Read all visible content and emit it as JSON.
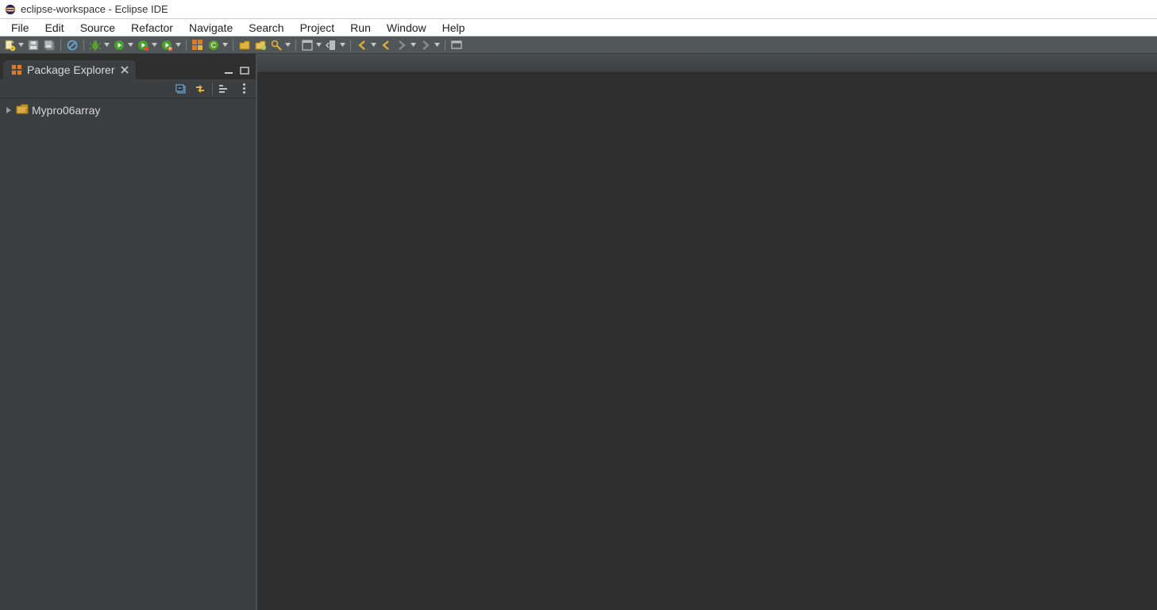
{
  "window": {
    "title": "eclipse-workspace - Eclipse IDE"
  },
  "menubar": {
    "items": [
      "File",
      "Edit",
      "Source",
      "Refactor",
      "Navigate",
      "Search",
      "Project",
      "Run",
      "Window",
      "Help"
    ]
  },
  "toolbar": {
    "groups": [
      {
        "items": [
          {
            "name": "new-button",
            "kind": "new",
            "drop": true
          },
          {
            "name": "save-button",
            "kind": "save",
            "drop": false
          },
          {
            "name": "save-all-button",
            "kind": "saveall",
            "drop": false
          }
        ]
      },
      {
        "items": [
          {
            "name": "skip-breakpoints-button",
            "kind": "skipbp",
            "drop": false
          }
        ]
      },
      {
        "items": [
          {
            "name": "debug-button",
            "kind": "debug",
            "drop": true
          },
          {
            "name": "run-button",
            "kind": "run",
            "drop": true
          },
          {
            "name": "coverage-button",
            "kind": "coverage",
            "drop": true
          },
          {
            "name": "external-tools-button",
            "kind": "ext",
            "drop": true
          }
        ]
      },
      {
        "items": [
          {
            "name": "new-package-button",
            "kind": "newpkg",
            "drop": false
          },
          {
            "name": "new-class-button",
            "kind": "newclass",
            "drop": true
          }
        ]
      },
      {
        "items": [
          {
            "name": "open-type-button",
            "kind": "opentype",
            "drop": false
          },
          {
            "name": "open-task-button",
            "kind": "opentask",
            "drop": false
          },
          {
            "name": "search-button",
            "kind": "torch",
            "drop": true
          }
        ]
      },
      {
        "items": [
          {
            "name": "toggle-editor-button",
            "kind": "toggleed",
            "drop": true
          },
          {
            "name": "goto-annotation-button",
            "kind": "gotoann",
            "drop": true
          }
        ]
      },
      {
        "items": [
          {
            "name": "nav-back-button",
            "kind": "navback",
            "drop": true
          },
          {
            "name": "nav-back2-button",
            "kind": "navback2",
            "drop": false
          },
          {
            "name": "nav-forward-button",
            "kind": "navfwd",
            "drop": true
          },
          {
            "name": "nav-forward2-button",
            "kind": "navfwd2",
            "drop": true
          }
        ]
      },
      {
        "items": [
          {
            "name": "pin-editor-button",
            "kind": "pin",
            "drop": false
          }
        ]
      }
    ]
  },
  "sidebar": {
    "view_title": "Package Explorer",
    "view_toolbar": {
      "collapse_all": "collapse-all-icon",
      "link_editor": "link-with-editor-icon",
      "filters": "filter-icon",
      "menu": "view-menu-icon"
    },
    "tree": {
      "items": [
        {
          "label": "Mypro06array",
          "kind": "java-project",
          "expanded": false
        }
      ]
    }
  }
}
